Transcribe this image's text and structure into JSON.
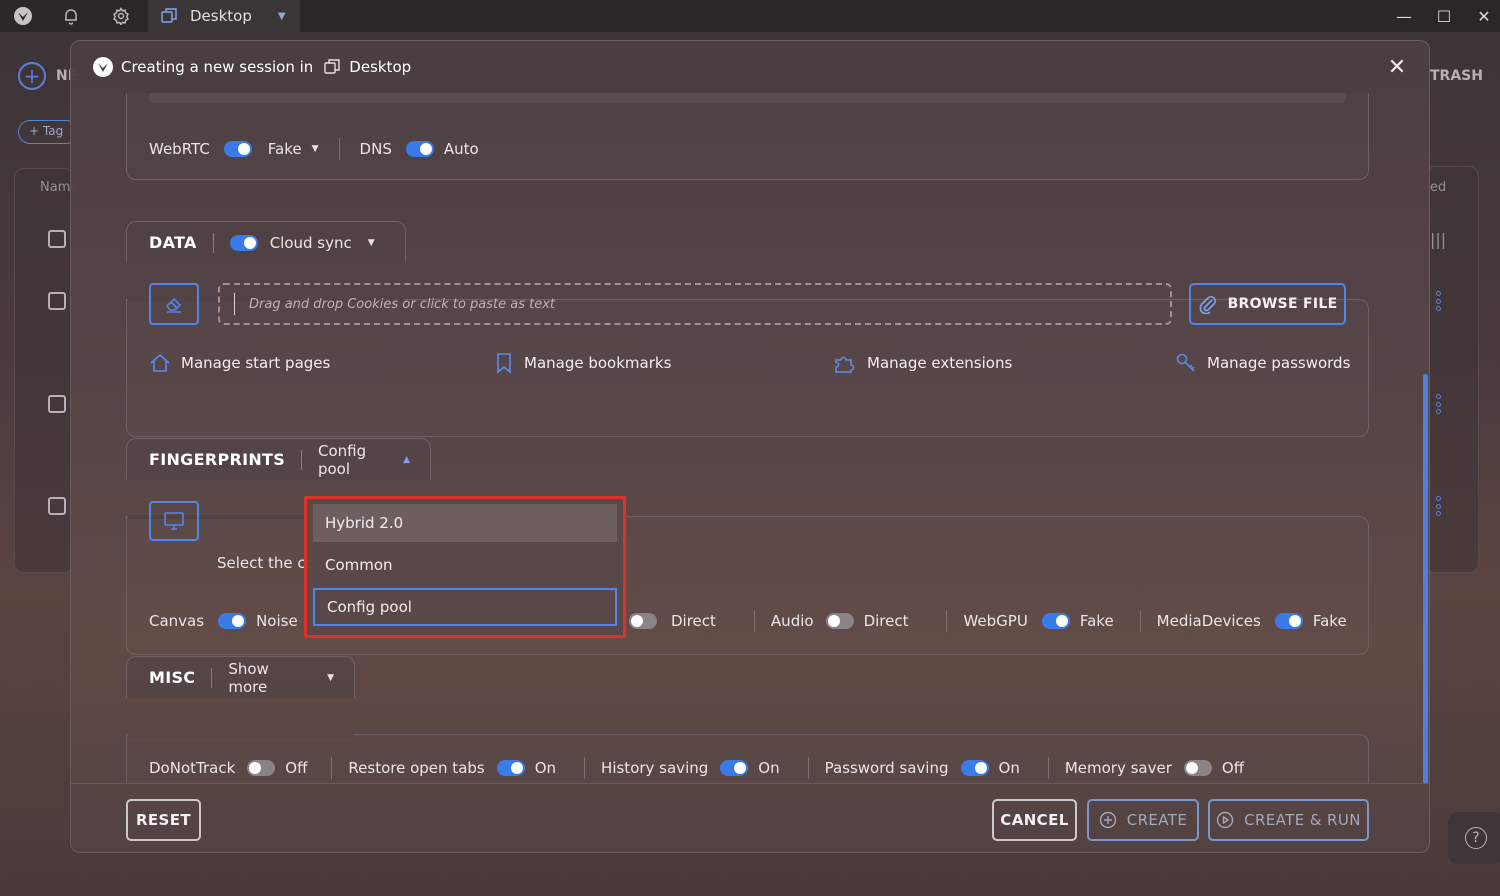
{
  "titlebar": {
    "tab_label": "Desktop"
  },
  "background": {
    "new_label": "NE",
    "tag_label": "Tag",
    "name_header": "Name",
    "right_header": "ed",
    "trash_label": "TRASH"
  },
  "modal": {
    "title_prefix": "Creating a new session in",
    "workspace": "Desktop"
  },
  "network": {
    "webrtc_label": "WebRTC",
    "webrtc_value": "Fake",
    "dns_label": "DNS",
    "dns_value": "Auto"
  },
  "data_section": {
    "title": "DATA",
    "cloud_sync_label": "Cloud sync",
    "drop_placeholder": "Drag and drop Cookies or click to paste as text",
    "browse_label": "BROWSE FILE",
    "manage_start_pages": "Manage start pages",
    "manage_bookmarks": "Manage bookmarks",
    "manage_extensions": "Manage extensions",
    "manage_passwords": "Manage passwords"
  },
  "fingerprints": {
    "title": "FINGERPRINTS",
    "mode_label": "Config pool",
    "select_label": "Select the cc",
    "canvas_label": "Canvas",
    "canvas_value": "Noise",
    "webgl_value": "Direct",
    "audio_label": "Audio",
    "audio_value": "Direct",
    "webgpu_label": "WebGPU",
    "webgpu_value": "Fake",
    "mediadevices_label": "MediaDevices",
    "mediadevices_value": "Fake"
  },
  "dropdown": {
    "options": [
      "Hybrid 2.0",
      "Common",
      "Config pool"
    ],
    "hovered": "Hybrid 2.0",
    "selected": "Config pool"
  },
  "misc": {
    "title": "MISC",
    "show_more_label": "Show more",
    "donottrack_label": "DoNotTrack",
    "donottrack_value": "Off",
    "restore_tabs_label": "Restore open tabs",
    "restore_tabs_value": "On",
    "history_label": "History saving",
    "history_value": "On",
    "password_label": "Password saving",
    "password_value": "On",
    "memory_label": "Memory saver",
    "memory_value": "Off"
  },
  "footer": {
    "reset_label": "RESET",
    "cancel_label": "CANCEL",
    "create_label": "CREATE",
    "create_run_label": "CREATE & RUN"
  },
  "colors": {
    "accent": "#3a7be8",
    "highlight_border": "#e0302a"
  }
}
